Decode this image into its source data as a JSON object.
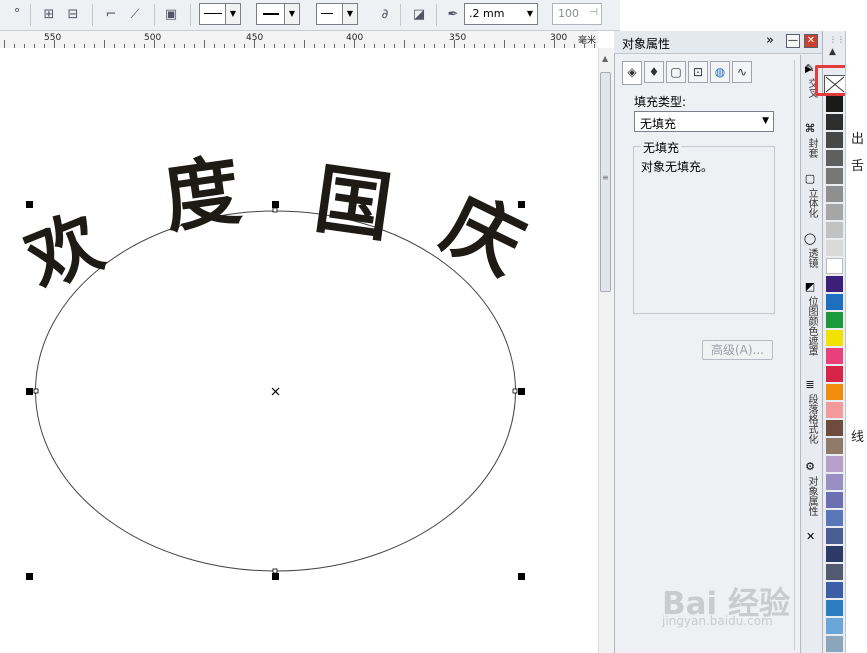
{
  "toolbar": {
    "dot": "°",
    "outline_width": ".2 mm",
    "scale_value": "100",
    "icons": [
      "align-icon",
      "distribute-icon",
      "connector-icon",
      "dimension-icon",
      "wrap-icon",
      "start-arrow-icon",
      "line-style-icon",
      "end-arrow-icon",
      "envelope-icon",
      "shadow-icon",
      "pen-icon"
    ]
  },
  "ruler": {
    "labels": [
      "550",
      "500",
      "450",
      "400",
      "350",
      "300"
    ],
    "unit": "毫米"
  },
  "canvas": {
    "text_glyphs": [
      "欢",
      "度",
      "国",
      "庆"
    ],
    "text_color": "#1e1b16",
    "ellipse_stroke": "#444444"
  },
  "docker": {
    "title": "对象属性",
    "expand_glyph": "»",
    "tabs": [
      "fill-icon",
      "outline-pen-icon",
      "frame-icon",
      "image-icon",
      "globe-icon",
      "curve-icon"
    ],
    "fill_type_label": "填充类型:",
    "fill_type_value": "无填充",
    "group_title": "无填充",
    "group_desc": "对象无填充。",
    "advanced_button": "高级(A)..."
  },
  "vertical_tabs": [
    {
      "label": "交叉",
      "icon": "blend-icon"
    },
    {
      "label": "封套",
      "icon": "envelope-icon"
    },
    {
      "label": "立体化",
      "icon": "extrude-icon"
    },
    {
      "label": "透镜",
      "icon": "lens-icon"
    },
    {
      "label": "位图颜色遮罩",
      "icon": "bitmap-mask-icon"
    },
    {
      "label": "段落格式化",
      "icon": "paragraph-icon"
    },
    {
      "label": "对象属性",
      "icon": "properties-icon"
    }
  ],
  "vertical_tab_close": "✕",
  "palette": {
    "colors": [
      "#1a1a1a",
      "#2e2e2e",
      "#474747",
      "#5f5f5f",
      "#777777",
      "#8f8f8f",
      "#a6a6a6",
      "#c2c2c2",
      "#dadada",
      "#ffffff",
      "#3b1f7a",
      "#1f6fc0",
      "#1a9a3a",
      "#f2e200",
      "#e8407a",
      "#d9244a",
      "#f28c0d",
      "#f39b9b",
      "#6f4b3e",
      "#8f7a6a",
      "#b69fca",
      "#9a8fc2",
      "#6c6fb0",
      "#5977b8",
      "#4b5e93",
      "#2e3a66",
      "#525a72",
      "#3b5fa6",
      "#2b7dc3",
      "#6aa6d6",
      "#8ba6bb"
    ]
  },
  "edge_text": [
    "出",
    "舌",
    "线"
  ],
  "watermark": {
    "main": "Bai 经验",
    "url": "jingyan.baidu.com"
  }
}
